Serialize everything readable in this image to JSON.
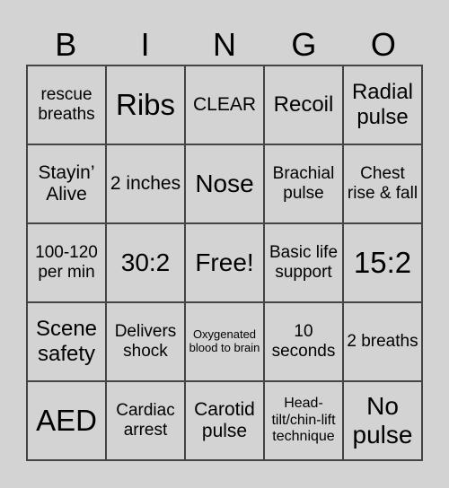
{
  "header": [
    "B",
    "I",
    "N",
    "G",
    "O"
  ],
  "cells": [
    "rescue breaths",
    "Ribs",
    "CLEAR",
    "Recoil",
    "Radial pulse",
    "Stayin’ Alive",
    "2 inches",
    "Nose",
    "Brachial pulse",
    "Chest rise & fall",
    "100-120 per min",
    "30:2",
    "Free!",
    "Basic life support",
    "15:2",
    "Scene safety",
    "Delivers shock",
    "Oxygenated blood to brain",
    "10 seconds",
    "2 breaths",
    "AED",
    "Cardiac arrest",
    "Carotid pulse",
    "Head-tilt/chin-lift technique",
    "No pulse"
  ]
}
